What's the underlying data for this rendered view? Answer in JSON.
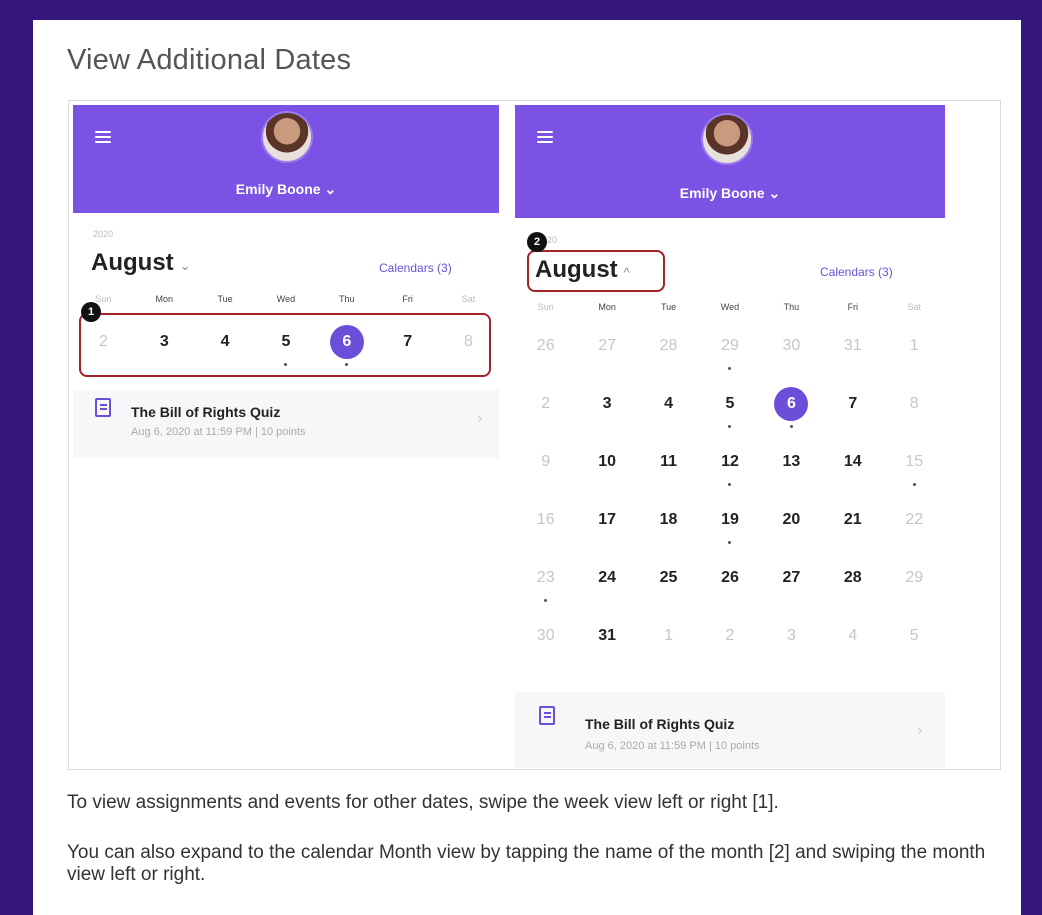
{
  "page": {
    "title": "View Additional Dates",
    "paragraph1": "To view assignments and events for other dates, swipe the week view left or right [1].",
    "paragraph2": "You can also expand to the calendar Month view by tapping the name of the month [2] and swiping the month view left or right."
  },
  "left_screen": {
    "user_name": "Emily Boone ⌄",
    "year": "2020",
    "month": "August",
    "month_caret": "⌄",
    "calendars_link": "Calendars (3)",
    "weekdays": [
      "Sun",
      "Mon",
      "Tue",
      "Wed",
      "Thu",
      "Fri",
      "Sat"
    ],
    "week": [
      {
        "label": "2",
        "dim": true,
        "dot": false,
        "selected": false
      },
      {
        "label": "3",
        "dim": false,
        "dot": false,
        "selected": false
      },
      {
        "label": "4",
        "dim": false,
        "dot": false,
        "selected": false
      },
      {
        "label": "5",
        "dim": false,
        "dot": true,
        "selected": false
      },
      {
        "label": "6",
        "dim": false,
        "dot": true,
        "selected": true
      },
      {
        "label": "7",
        "dim": false,
        "dot": false,
        "selected": false
      },
      {
        "label": "8",
        "dim": true,
        "dot": false,
        "selected": false
      }
    ],
    "marker": "1",
    "event": {
      "title": "The Bill of Rights Quiz",
      "meta": "Aug 6, 2020 at 11:59 PM  |  10 points",
      "chevron": "›"
    }
  },
  "right_screen": {
    "user_name": "Emily Boone ⌄",
    "year": "2020",
    "month": "August",
    "month_caret": "^",
    "calendars_link": "Calendars (3)",
    "marker": "2",
    "weekdays": [
      "Sun",
      "Mon",
      "Tue",
      "Wed",
      "Thu",
      "Fri",
      "Sat"
    ],
    "weeks": [
      [
        {
          "label": "26",
          "dim": true,
          "dot": false,
          "selected": false
        },
        {
          "label": "27",
          "dim": true,
          "dot": false,
          "selected": false
        },
        {
          "label": "28",
          "dim": true,
          "dot": false,
          "selected": false
        },
        {
          "label": "29",
          "dim": true,
          "dot": true,
          "selected": false
        },
        {
          "label": "30",
          "dim": true,
          "dot": false,
          "selected": false
        },
        {
          "label": "31",
          "dim": true,
          "dot": false,
          "selected": false
        },
        {
          "label": "1",
          "dim": true,
          "dot": false,
          "selected": false
        }
      ],
      [
        {
          "label": "2",
          "dim": true,
          "dot": false,
          "selected": false
        },
        {
          "label": "3",
          "dim": false,
          "dot": false,
          "selected": false
        },
        {
          "label": "4",
          "dim": false,
          "dot": false,
          "selected": false
        },
        {
          "label": "5",
          "dim": false,
          "dot": true,
          "selected": false
        },
        {
          "label": "6",
          "dim": false,
          "dot": true,
          "selected": true
        },
        {
          "label": "7",
          "dim": false,
          "dot": false,
          "selected": false
        },
        {
          "label": "8",
          "dim": true,
          "dot": false,
          "selected": false
        }
      ],
      [
        {
          "label": "9",
          "dim": true,
          "dot": false,
          "selected": false
        },
        {
          "label": "10",
          "dim": false,
          "dot": false,
          "selected": false
        },
        {
          "label": "11",
          "dim": false,
          "dot": false,
          "selected": false
        },
        {
          "label": "12",
          "dim": false,
          "dot": true,
          "selected": false
        },
        {
          "label": "13",
          "dim": false,
          "dot": false,
          "selected": false
        },
        {
          "label": "14",
          "dim": false,
          "dot": false,
          "selected": false
        },
        {
          "label": "15",
          "dim": true,
          "dot": true,
          "selected": false
        }
      ],
      [
        {
          "label": "16",
          "dim": true,
          "dot": false,
          "selected": false
        },
        {
          "label": "17",
          "dim": false,
          "dot": false,
          "selected": false
        },
        {
          "label": "18",
          "dim": false,
          "dot": false,
          "selected": false
        },
        {
          "label": "19",
          "dim": false,
          "dot": true,
          "selected": false
        },
        {
          "label": "20",
          "dim": false,
          "dot": false,
          "selected": false
        },
        {
          "label": "21",
          "dim": false,
          "dot": false,
          "selected": false
        },
        {
          "label": "22",
          "dim": true,
          "dot": false,
          "selected": false
        }
      ],
      [
        {
          "label": "23",
          "dim": true,
          "dot": true,
          "selected": false
        },
        {
          "label": "24",
          "dim": false,
          "dot": false,
          "selected": false
        },
        {
          "label": "25",
          "dim": false,
          "dot": false,
          "selected": false
        },
        {
          "label": "26",
          "dim": false,
          "dot": false,
          "selected": false
        },
        {
          "label": "27",
          "dim": false,
          "dot": false,
          "selected": false
        },
        {
          "label": "28",
          "dim": false,
          "dot": false,
          "selected": false
        },
        {
          "label": "29",
          "dim": true,
          "dot": false,
          "selected": false
        }
      ],
      [
        {
          "label": "30",
          "dim": true,
          "dot": false,
          "selected": false
        },
        {
          "label": "31",
          "dim": false,
          "dot": false,
          "selected": false
        },
        {
          "label": "1",
          "dim": true,
          "dot": false,
          "selected": false
        },
        {
          "label": "2",
          "dim": true,
          "dot": false,
          "selected": false
        },
        {
          "label": "3",
          "dim": true,
          "dot": false,
          "selected": false
        },
        {
          "label": "4",
          "dim": true,
          "dot": false,
          "selected": false
        },
        {
          "label": "5",
          "dim": true,
          "dot": false,
          "selected": false
        }
      ]
    ],
    "event": {
      "title": "The Bill of Rights Quiz",
      "meta": "Aug 6, 2020 at 11:59 PM  |  10 points",
      "chevron": "›"
    }
  },
  "colors": {
    "page_bg": "#34157a",
    "header_purple": "#7b52e3",
    "accent": "#6b4fd8",
    "callout_red": "#a2232a"
  },
  "icons": [
    "hamburger-menu-icon",
    "avatar",
    "assignment-icon",
    "chevron-right-icon",
    "caret-down-icon"
  ]
}
